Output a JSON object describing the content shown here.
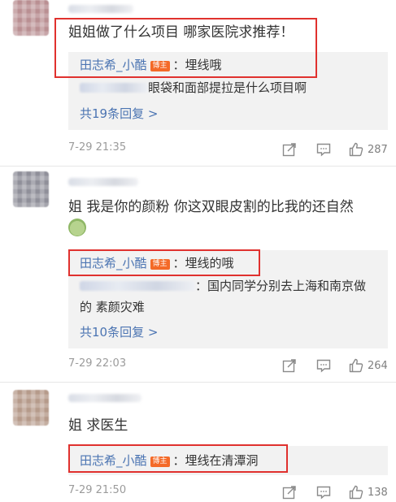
{
  "comments": [
    {
      "text": "姐姐做了什么项目 哪家医院求推荐！",
      "reply": {
        "author": "田志希_小酷",
        "badge": "博主",
        "text": "：埋线哦"
      },
      "sub_reply": {
        "text": "眼袋和面部提拉是什么项目啊"
      },
      "more": "共19条回复 >",
      "time": "7-29 21:35",
      "likes": "287"
    },
    {
      "text": "姐 我是你的颜粉 你这双眼皮割的比我的还自然",
      "reply": {
        "author": "田志希_小酷",
        "badge": "博主",
        "text": "：埋线的哦"
      },
      "sub_reply": {
        "text": "：国内同学分别去上海和南京做",
        "text2": "的 素颜灾难"
      },
      "more": "共10条回复 >",
      "time": "7-29 22:03",
      "likes": "264"
    },
    {
      "text": "姐 求医生",
      "reply": {
        "author": "田志希_小酷",
        "badge": "博主",
        "text": "：埋线在清潭洞"
      },
      "time": "7-29 21:50",
      "likes": "138"
    }
  ],
  "icons": {
    "share": "share-icon",
    "comment": "comment-icon",
    "like": "thumbs-up-icon"
  },
  "colors": {
    "highlight": "#e0312e",
    "link": "#4b74b2",
    "badge": "#f46a28",
    "reply_bg": "#f2f2f2"
  }
}
